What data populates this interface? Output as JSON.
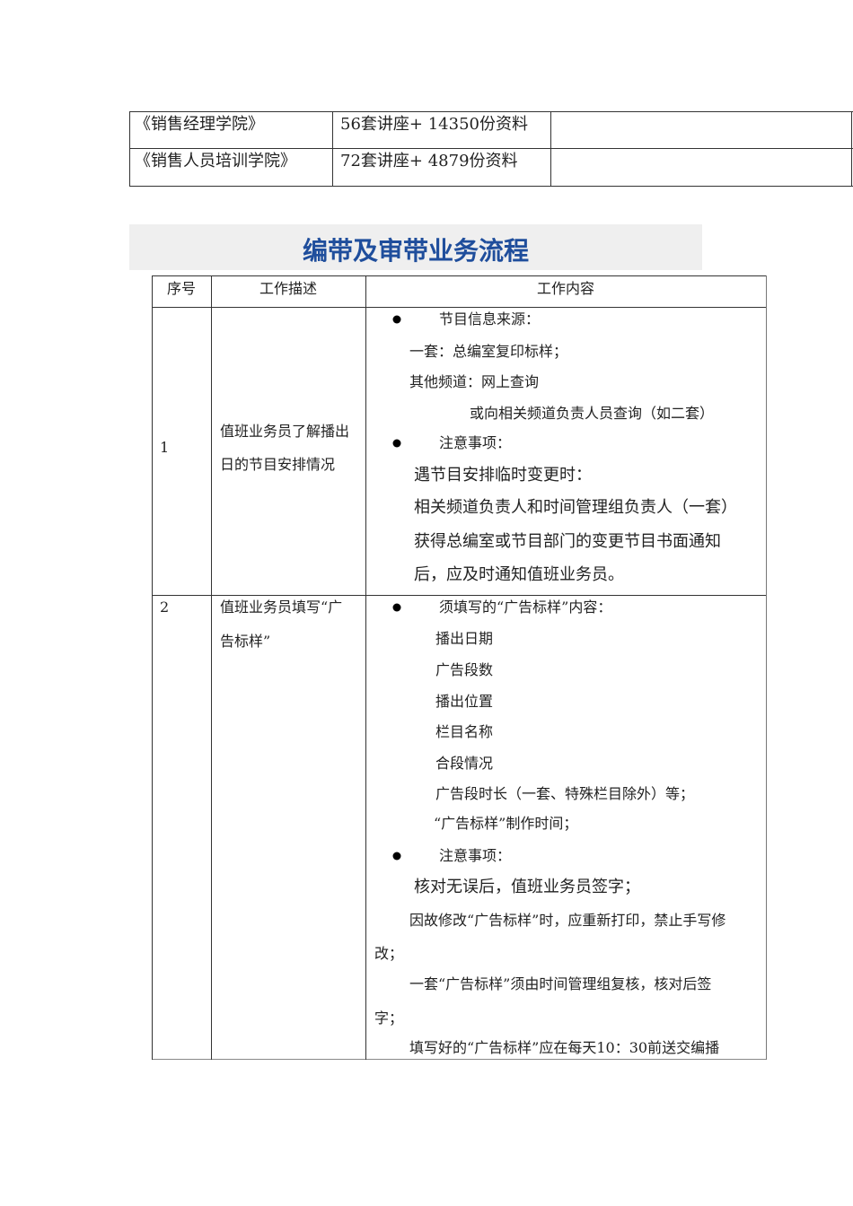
{
  "top_table": {
    "rows": [
      {
        "name": "《销售经理学院》",
        "content": "56套讲座+ 14350份资料",
        "extra": ""
      },
      {
        "name": "《销售人员培训学院》",
        "content": "72套讲座+ 4879份资料",
        "extra": ""
      }
    ]
  },
  "section_title": "编带及审带业务流程",
  "flow_table": {
    "headers": [
      "序号",
      "工作描述",
      "工作内容"
    ],
    "rows": [
      {
        "no": "1",
        "desc": [
          "值班业务员了解播出",
          "日的节目安排情况"
        ],
        "content": {
          "b1": "节目信息来源：",
          "l1": "一套：总编室复印标样；",
          "l2": "其他频道：网上查询",
          "l3": "或向相关频道负责人员查询（如二套）",
          "b2": "注意事项：",
          "n1": "遇节目安排临时变更时：",
          "n2": "相关频道负责人和时间管理组负责人（一套）",
          "n3": "获得总编室或节目部门的变更节目书面通知",
          "n4": "后，应及时通知值班业务员。"
        }
      },
      {
        "no": "2",
        "desc": [
          "值班业务员填写“广",
          "告标样”"
        ],
        "content": {
          "b1": "须填写的“广告标样”内容：",
          "items": [
            "播出日期",
            "广告段数",
            "播出位置",
            "栏目名称",
            "合段情况",
            "广告段时长（一套、特殊栏目除外）等；",
            "“广告标样”制作时间；"
          ],
          "b2": "注意事项：",
          "n1": "核对无误后，值班业务员签字；",
          "n2a": "因故修改“广告标样”时，应重新打印，禁止手写修",
          "n2b": "改；",
          "n3a": "一套“广告标样”须由时间管理组复核，核对后签",
          "n3b": "字；",
          "n4": "填写好的“广告标样”应在每天10：30前送交编播"
        }
      }
    ]
  }
}
